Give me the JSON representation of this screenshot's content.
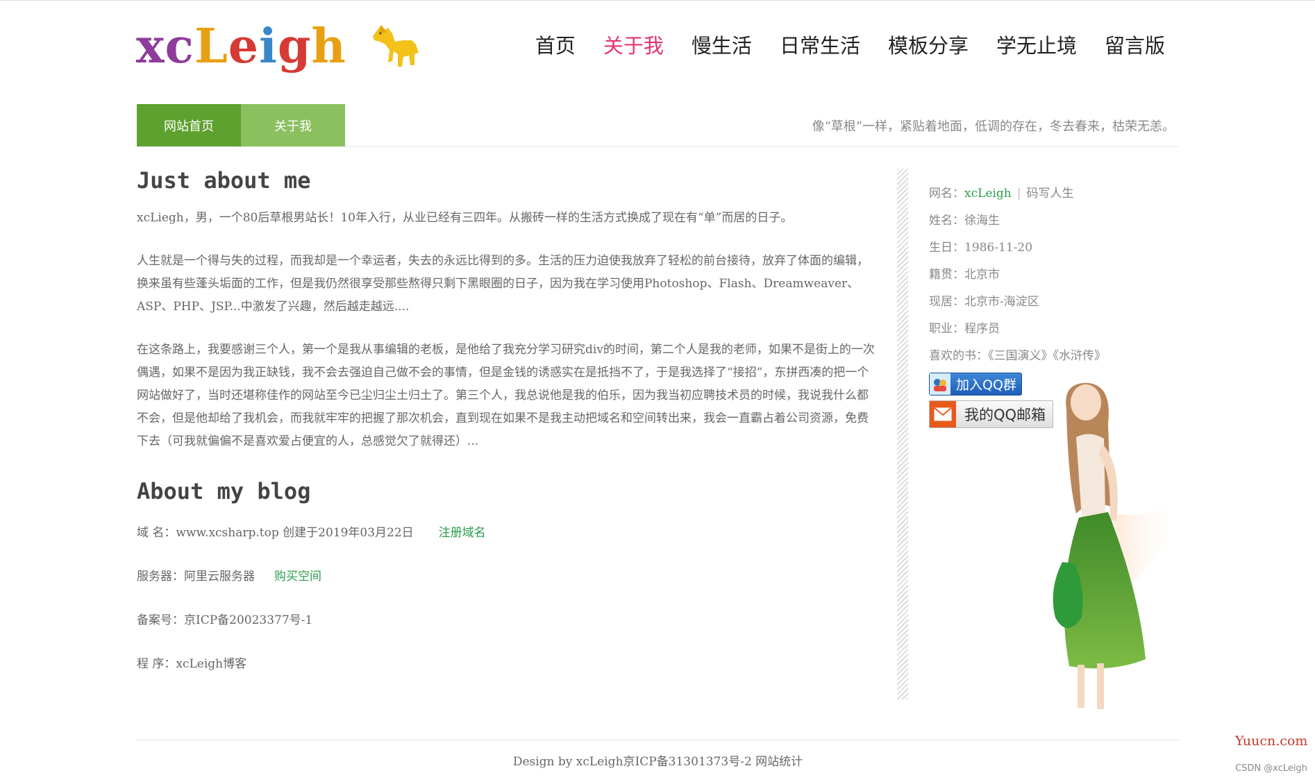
{
  "header": {
    "logo_text": [
      "x",
      "c",
      "L",
      "e",
      "i",
      "g",
      "h"
    ],
    "logo_colors": [
      "#8e3c9b",
      "#8e3c9b",
      "#e8a013",
      "#d53a34",
      "#3a87c8",
      "#d53a34",
      "#e8a013"
    ],
    "nav": [
      {
        "label": "首页",
        "active": false
      },
      {
        "label": "关于我",
        "active": true
      },
      {
        "label": "慢生活",
        "active": false
      },
      {
        "label": "日常生活",
        "active": false
      },
      {
        "label": "模板分享",
        "active": false
      },
      {
        "label": "学无止境",
        "active": false
      },
      {
        "label": "留言版",
        "active": false
      }
    ]
  },
  "subbar": {
    "home_label": "网站首页",
    "about_label": "关于我",
    "motto": "像“草根”一样，紧贴着地面，低调的存在，冬去春来，枯荣无恙。"
  },
  "main": {
    "h1": "Just about me",
    "paragraphs": [
      "xcLiegh，男，一个80后草根男站长！10年入行，从业已经有三四年。从搬砖一样的生活方式换成了现在有“单”而居的日子。",
      "人生就是一个得与失的过程，而我却是一个幸运者，失去的永远比得到的多。生活的压力迫使我放弃了轻松的前台接待，放弃了体面的编辑，换来虽有些蓬头垢面的工作，但是我仍然很享受那些熬得只剩下黑眼圈的日子，因为我在学习使用Photoshop、Flash、Dreamweaver、ASP、PHP、JSP...中激发了兴趣，然后越走越远....",
      "在这条路上，我要感谢三个人，第一个是我从事编辑的老板，是他给了我充分学习研究div的时间，第二个人是我的老师，如果不是街上的一次偶遇，如果不是因为我正缺钱，我不会去强迫自己做不会的事情，但是金钱的诱惑实在是抵挡不了，于是我选择了“接招”，东拼西凑的把一个网站做好了，当时还堪称佳作的网站至今已尘归尘土归土了。第三个人，我总说他是我的伯乐，因为我当初应聘技术员的时候，我说我什么都不会，但是他却给了我机会，而我就牢牢的把握了那次机会，直到现在如果不是我主动把域名和空间转出来，我会一直霸占着公司资源，免费下去（可我就偏偏不是喜欢爱占便宜的人，总感觉欠了就得还）..."
    ],
    "h2": "About my blog",
    "blog": {
      "domain": "域 名：www.xcsharp.top 创建于2019年03月22日",
      "domain_link": "注册域名",
      "server": "服务器：阿里云服务器",
      "server_link": "购买空间",
      "icp": "备案号：京ICP备20023377号-1",
      "program": "程 序：xcLeigh博客"
    }
  },
  "sidebar": {
    "nick_label": "网名：",
    "nick": "xcLeigh",
    "sep": "|",
    "nick_extra": "码写人生",
    "rows": [
      "姓名：徐海生",
      "生日：1986-11-20",
      "籍贯：北京市",
      "现居：北京市-海淀区",
      "职业：程序员",
      "喜欢的书：《三国演义》《水浒传》"
    ],
    "qq_group_label": "加入QQ群",
    "qq_mail_label": "我的QQ邮箱"
  },
  "footer": {
    "text": "Design by xcLeigh京ICP备31301373号-2 网站统计"
  },
  "watermark": {
    "site": "Yuucn.com",
    "csdn": "CSDN @xcLeigh"
  }
}
